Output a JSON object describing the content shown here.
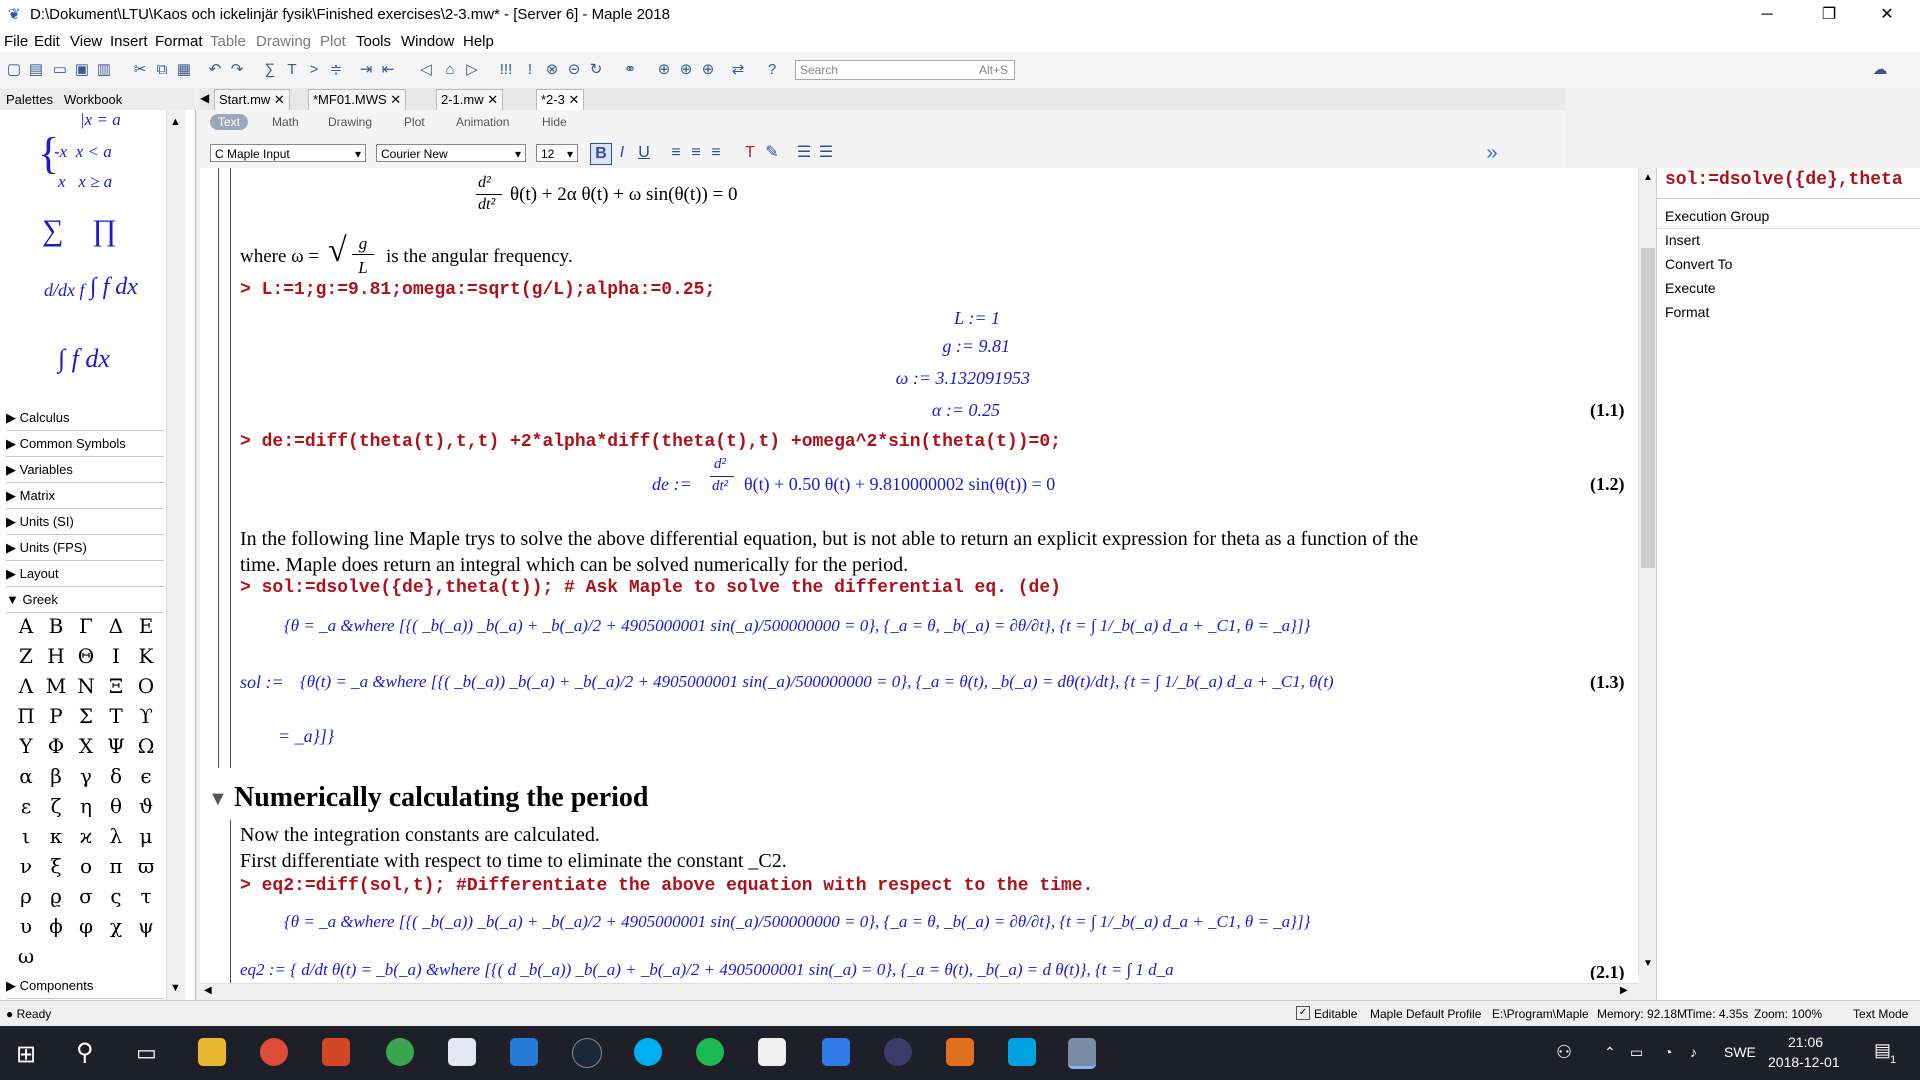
{
  "window": {
    "title": "D:\\Dokument\\LTU\\Kaos och ickelinjär fysik\\Finished exercises\\2-3.mw* - [Server 6] - Maple 2018"
  },
  "menu": [
    "File",
    "Edit",
    "View",
    "Insert",
    "Format",
    "Table",
    "Drawing",
    "Plot",
    "Tools",
    "Window",
    "Help"
  ],
  "search": {
    "placeholder": "Search",
    "shortcut": "Alt+S"
  },
  "left_tabs": [
    "Palettes",
    "Workbook"
  ],
  "palettes": [
    "Calculus",
    "Common Symbols",
    "Variables",
    "Matrix",
    "Units (SI)",
    "Units (FPS)",
    "Layout",
    "Greek",
    "Components"
  ],
  "greek_rows": [
    [
      "Α",
      "Β",
      "Γ",
      "Δ",
      "Ε"
    ],
    [
      "Ζ",
      "Η",
      "Θ",
      "Ι",
      "Κ"
    ],
    [
      "Λ",
      "Μ",
      "Ν",
      "Ξ",
      "Ο"
    ],
    [
      "Π",
      "Ρ",
      "Σ",
      "Τ",
      "ϒ"
    ],
    [
      "Υ",
      "Φ",
      "Χ",
      "Ψ",
      "Ω"
    ],
    [
      "α",
      "β",
      "γ",
      "δ",
      "ϵ"
    ],
    [
      "ε",
      "ζ",
      "η",
      "θ",
      "ϑ"
    ],
    [
      "ι",
      "κ",
      "ϰ",
      "λ",
      "μ"
    ],
    [
      "ν",
      "ξ",
      "ο",
      "π",
      "ϖ"
    ],
    [
      "ρ",
      "ϱ",
      "σ",
      "ς",
      "τ"
    ],
    [
      "υ",
      "ϕ",
      "φ",
      "χ",
      "ψ"
    ],
    [
      "ω",
      "",
      "",
      "",
      ""
    ]
  ],
  "doc_tabs": [
    "Start.mw",
    "*MF01.MWS",
    "2-1.mw",
    "*2-3"
  ],
  "modes": [
    "Text",
    "Math",
    "Drawing",
    "Plot",
    "Animation",
    "Hide"
  ],
  "format": {
    "style": "Maple Input",
    "font": "Courier New",
    "size": "12"
  },
  "document": {
    "eq_top": "θ(t) + 2α θ(t) + ω sin(θ(t)) = 0",
    "where_text": "where ω =",
    "where_tail": "is the angular frequency.",
    "cmd1": "L:=1;g:=9.81;omega:=sqrt(g/L);alpha:=0.25;",
    "out1": [
      "L := 1",
      "g := 9.81",
      "ω := 3.132091953",
      "α := 0.25"
    ],
    "label1": "(1.1)",
    "cmd2": "de:=diff(theta(t),t,t) +2*alpha*diff(theta(t),t) +omega^2*sin(theta(t))=0;",
    "out2": "θ(t) + 0.50   θ(t) + 9.810000002 sin(θ(t)) = 0",
    "out2_lhs": "de :=",
    "label2": "(1.2)",
    "para1": "In the following line Maple trys to solve the above differential equation, but is not able to return an explicit expression for theta as a function of the",
    "para1b": "time.  Maple does return an integral which can be solved numerically for the period.",
    "cmd3": "sol:=dsolve({de},theta(t)); # Ask Maple to solve the differential eq. (de)",
    "out3a": "{θ = _a &where [{( _b(_a)) _b(_a) + _b(_a)/2 + 4905000001 sin(_a)/500000000 = 0}, {_a = θ, _b(_a) = ∂θ/∂t}, {t = ∫ 1/_b(_a) d_a + _C1, θ = _a}]}",
    "out3_lhs": "sol :=",
    "out3b": "{θ(t) = _a &where [{( _b(_a)) _b(_a) + _b(_a)/2 + 4905000001 sin(_a)/500000000 = 0}, {_a = θ(t), _b(_a) = dθ(t)/dt}, {t = ∫ 1/_b(_a) d_a + _C1, θ(t)",
    "out3c": "= _a}]}",
    "label3": "(1.3)",
    "heading": "Numerically calculating the period",
    "para2": "Now the integration constants are calculated.",
    "para3": "First differentiate with respect to time to eliminate the constant _C2.",
    "cmd4": "eq2:=diff(sol,t); #Differentiate the above equation with respect to the time.",
    "out4a": "{θ = _a &where [{( _b(_a)) _b(_a) + _b(_a)/2 + 4905000001 sin(_a)/500000000 = 0}, {_a = θ, _b(_a) = ∂θ/∂t}, {t = ∫ 1/_b(_a) d_a + _C1, θ = _a}]}",
    "out4_partial": "eq2 := { d/dt θ(t) = _b(_a) &where [{( d _b(_a)) _b(_a) + _b(_a)/2 + 4905000001 sin(_a) = 0}, {_a = θ(t), _b(_a) = d θ(t)}, {t = ∫ 1 d_a",
    "label4": "(2.1)"
  },
  "context_panel": {
    "title": "sol:=dsolve({de},theta",
    "items": [
      "Execution Group",
      "Insert",
      "Convert To",
      "Execute",
      "Format"
    ]
  },
  "status": {
    "left": "Ready",
    "editable": "Editable",
    "profile": "Maple Default Profile",
    "path": "E:\\Program\\Maple",
    "memory": "Memory: 92.18M",
    "time": "Time: 4.35s",
    "zoom": "Zoom: 100%",
    "mode": "Text Mode"
  },
  "taskbar": {
    "lang": "SWE",
    "clock": "21:06",
    "date": "2018-12-01",
    "notif": "1"
  },
  "colors": {
    "command": "#b0101a",
    "output": "#1b1bd0",
    "taskbar": "#1f1f2a"
  }
}
